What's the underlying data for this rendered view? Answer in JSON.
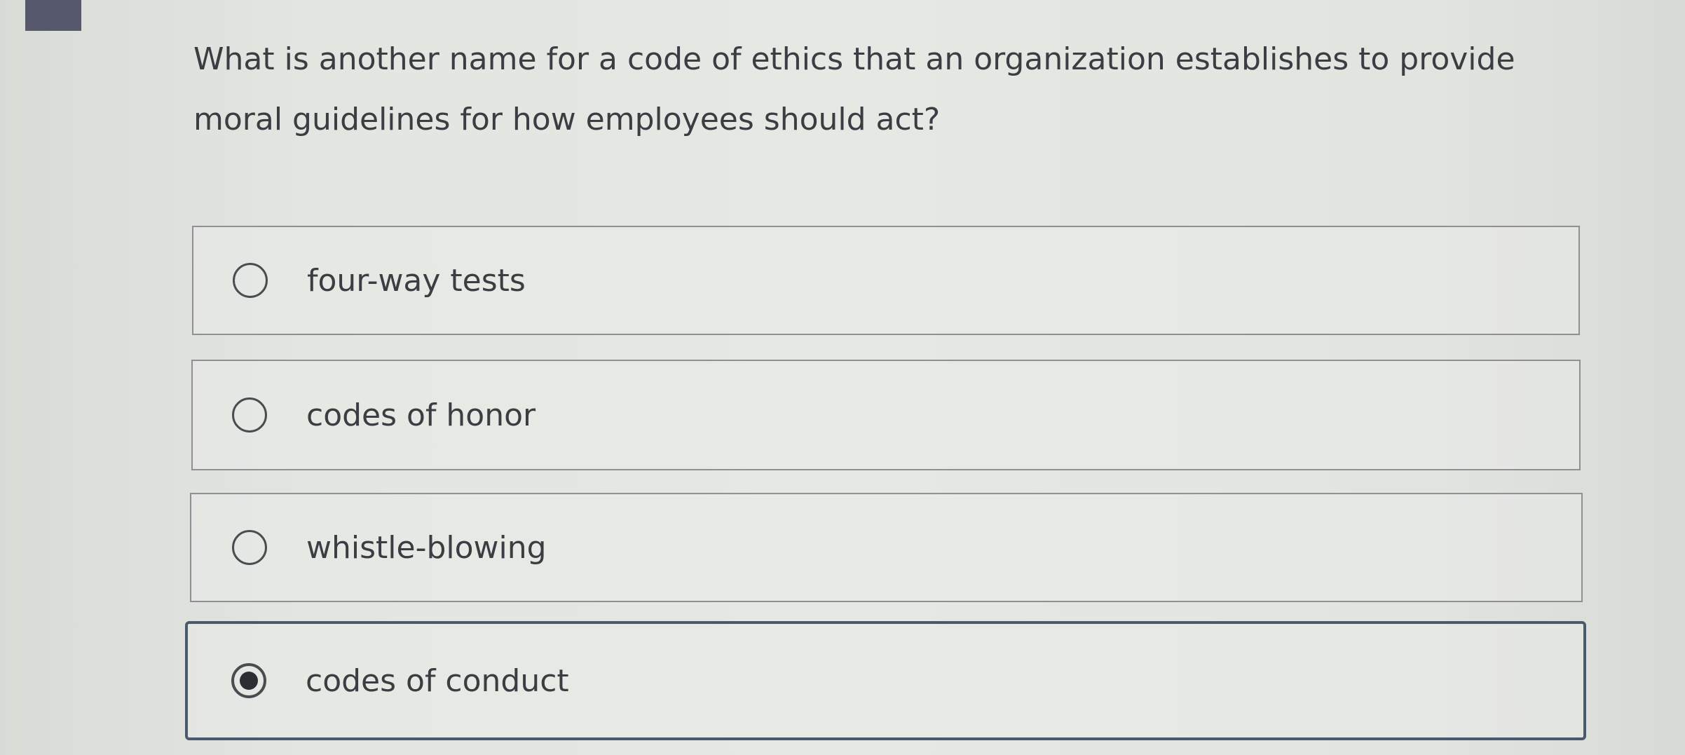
{
  "question": {
    "text": "What is another name for a code of ethics that an organization establishes to provide moral guidelines for how employees should act?"
  },
  "options": [
    {
      "label": "four-way tests",
      "selected": false
    },
    {
      "label": "codes of honor",
      "selected": false
    },
    {
      "label": "whistle-blowing",
      "selected": false
    },
    {
      "label": "codes of conduct",
      "selected": true
    }
  ],
  "colors": {
    "background": "#e6e8e4",
    "option_border": "#8e9194",
    "selected_border": "#4a5a6c",
    "text": "#3a3d41"
  }
}
